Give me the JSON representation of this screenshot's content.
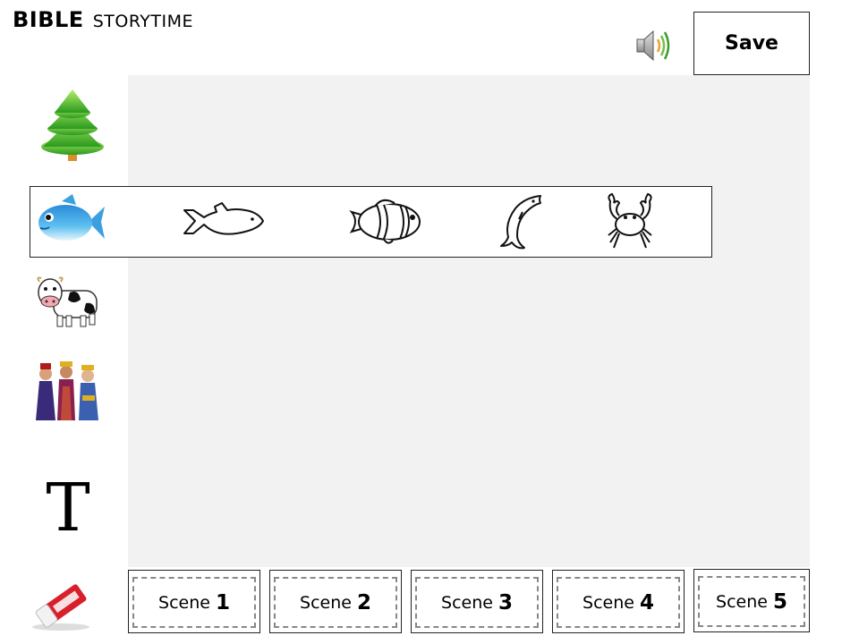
{
  "header": {
    "title_bold": "BIBLE",
    "title_rest": "STORYTIME",
    "save_label": "Save",
    "speaker_icon": "speaker-icon"
  },
  "toolbar": {
    "items": [
      {
        "name": "tree",
        "icon": "tree-icon"
      },
      {
        "name": "fish",
        "icon": "fish-icon"
      },
      {
        "name": "cow",
        "icon": "cow-icon"
      },
      {
        "name": "people",
        "icon": "wise-men-icon"
      },
      {
        "name": "text",
        "icon": "text-icon",
        "glyph": "T"
      },
      {
        "name": "eraser",
        "icon": "eraser-icon"
      }
    ]
  },
  "animal_tray": {
    "items": [
      {
        "name": "color-fish",
        "icon": "fish-icon"
      },
      {
        "name": "fish-outline",
        "icon": "fish-outline-icon"
      },
      {
        "name": "clownfish",
        "icon": "clownfish-icon"
      },
      {
        "name": "dolphin",
        "icon": "dolphin-icon"
      },
      {
        "name": "crab",
        "icon": "crab-icon"
      }
    ]
  },
  "scenes": [
    {
      "word": "Scene",
      "num": "1"
    },
    {
      "word": "Scene",
      "num": "2"
    },
    {
      "word": "Scene",
      "num": "3"
    },
    {
      "word": "Scene",
      "num": "4"
    },
    {
      "word": "Scene",
      "num": "5"
    }
  ],
  "colors": {
    "canvas": "#f2f2f2",
    "tree": "#3fae2a",
    "fish": "#39a9e8",
    "border": "#222222",
    "dashed": "#888888"
  }
}
